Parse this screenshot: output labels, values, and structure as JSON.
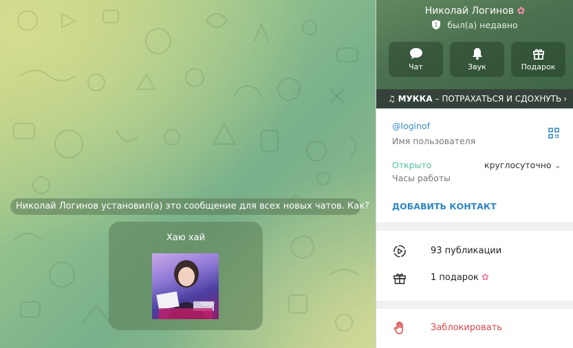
{
  "chat": {
    "pinned_note": "Николай Логинов установил(а) это сообщение для всех новых чатов. Как?",
    "message_title": "Хаю хай",
    "sticker_caption": "Yappy"
  },
  "profile": {
    "name": "Николай Логинов",
    "status": "был(а) недавно",
    "actions": [
      {
        "label": "Чат",
        "icon": "chat-bubble-icon"
      },
      {
        "label": "Звук",
        "icon": "bell-icon"
      },
      {
        "label": "Подарок",
        "icon": "gift-icon"
      }
    ],
    "music": {
      "artist": "МУККА",
      "separator": " – ",
      "title": "ПОТРАХАТЬСЯ И СДОХНУТЬ"
    },
    "username": "@loginof",
    "username_label": "Имя пользователя",
    "hours_state": "Открыто",
    "hours_value": "круглосуточно",
    "hours_label": "Часы работы",
    "add_contact": "ДОБАВИТЬ КОНТАКТ",
    "publications": "93 публикации",
    "gifts": "1 подарок",
    "block": "Заблокировать"
  },
  "colors": {
    "link": "#3a88c4",
    "open": "#4dbf9f",
    "danger": "#d9484c",
    "header": "#4c7150"
  }
}
